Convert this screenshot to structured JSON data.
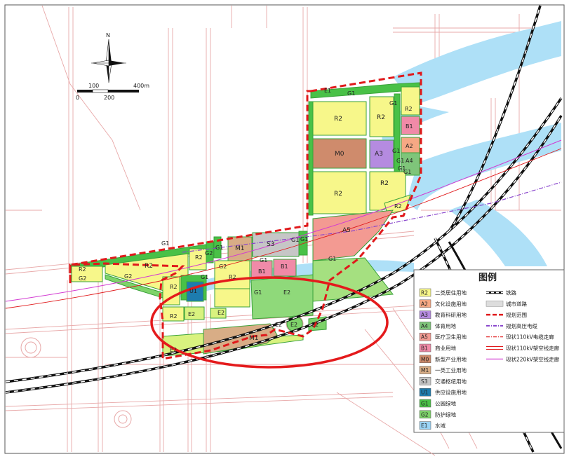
{
  "north_arrow": {
    "label": "N"
  },
  "scale_bar": {
    "labels": [
      "0",
      "100",
      "200",
      "400m"
    ]
  },
  "colors": {
    "R2": "#f7f78a",
    "A2": "#f6a884",
    "A3": "#b58be0",
    "A4": "#7fc57a",
    "A5": "#f39a92",
    "B1": "#f08aa8",
    "M0": "#cf8b6c",
    "M1": "#d8ad86",
    "S3": "#c6c6c6",
    "U1": "#1d7cae",
    "G1": "#49c147",
    "G2": "#7ed36a",
    "E1": "#9bd4f5",
    "water": "#aee0f7",
    "boundary": "#e0191b",
    "ellipse": "#e41a1c"
  },
  "plot_labels": {
    "e1": "E1",
    "g1_top": "G1",
    "r2_a": "R2",
    "r2_b": "R2",
    "r2_c": "R2",
    "b1_a": "B1",
    "g1_b": "G1",
    "g1_c": "G1",
    "m0": "M0",
    "a3": "A3",
    "a2": "A2",
    "a4": "A4",
    "g1_d": "G1",
    "r2_d": "R2",
    "r2_e": "R2",
    "r2_f": "R2",
    "a5": "A5",
    "g2_a": "G2",
    "r2_g": "R2",
    "g2_b": "G2",
    "r2_h": "R2",
    "g1_e": "G1",
    "g2_c": "G2",
    "r2_i": "R2",
    "m1_a": "M1",
    "s3": "S3",
    "g1_f": "G1",
    "g1_g": "G1",
    "g2_d": "G2",
    "b1_b": "B1",
    "b1_c": "B1",
    "r2_j": "R2",
    "u1": "U1",
    "g1_h": "G1",
    "e2_a": "E2",
    "e2_b": "E2",
    "g1_i": "G1",
    "r2_k": "R2",
    "e2_c": "E2",
    "r2_l": "R2",
    "g1_j": "G1",
    "g1_k": "G1",
    "e2_d": "E2",
    "m1_b": "M1",
    "e2_e": "E2",
    "e2_f": "E2",
    "e2_g": "E2",
    "g1_l": "G1",
    "g1_m": "G1",
    "g1_n": "G1"
  },
  "legend": {
    "title": "图例",
    "land_use": [
      {
        "code": "R2",
        "label": "二类居住用地",
        "color": "#f7f78a"
      },
      {
        "code": "A2",
        "label": "文化设施用地",
        "color": "#f6a884"
      },
      {
        "code": "A3",
        "label": "教育科研用地",
        "color": "#b58be0"
      },
      {
        "code": "A4",
        "label": "体育用地",
        "color": "#7fc57a"
      },
      {
        "code": "A5",
        "label": "医疗卫生用地",
        "color": "#f39a92"
      },
      {
        "code": "B1",
        "label": "商业用地",
        "color": "#f08aa8"
      },
      {
        "code": "M0",
        "label": "新型产业用地",
        "color": "#cf8b6c"
      },
      {
        "code": "M1",
        "label": "一类工业用地",
        "color": "#d8ad86"
      },
      {
        "code": "S3",
        "label": "交通枢纽用地",
        "color": "#c6c6c6"
      },
      {
        "code": "U1",
        "label": "供应设施用地",
        "color": "#1d7cae"
      },
      {
        "code": "G1",
        "label": "公园绿地",
        "color": "#49c147"
      },
      {
        "code": "G2",
        "label": "防护绿地",
        "color": "#7ed36a"
      },
      {
        "code": "E1",
        "label": "水域",
        "color": "#9bd4f5"
      }
    ],
    "lines": [
      {
        "label": "铁路",
        "style": "rail"
      },
      {
        "label": "城市道路",
        "style": "road"
      },
      {
        "label": "规划范围",
        "style": "boundary"
      },
      {
        "label": "规划高压电缆",
        "style": "cable"
      },
      {
        "label": "现状110kV电缆走廊",
        "style": "dashdot"
      },
      {
        "label": "现状110kV架空线走廊",
        "style": "redline"
      },
      {
        "label": "现状220kV架空线走廊",
        "style": "magenta"
      }
    ]
  }
}
